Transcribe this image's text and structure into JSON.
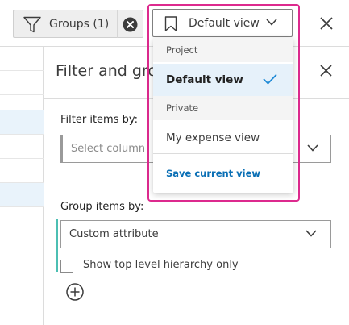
{
  "toolbar": {
    "groups_label": "Groups (1)",
    "view_selected": "Default view",
    "funnel_icon": "funnel-icon",
    "clear_icon": "clear-filter-icon",
    "bookmark_icon": "bookmark-icon",
    "close_icon": "close-icon"
  },
  "left_list": {
    "selected_rows": [
      2,
      6
    ]
  },
  "panel": {
    "title": "Filter and gro",
    "filter": {
      "label": "Filter items by:",
      "placeholder": "Select column"
    },
    "group": {
      "label": "Group items by:",
      "value": "Custom attribute"
    },
    "checkbox_label": "Show top level hierarchy only",
    "checkbox_checked": false,
    "add_icon": "add-circle-icon"
  },
  "view_menu": {
    "groups": [
      {
        "label": "Project",
        "items": [
          {
            "label": "Default view",
            "selected": true
          }
        ]
      },
      {
        "label": "Private",
        "items": [
          {
            "label": "My expense view",
            "selected": false
          }
        ]
      }
    ],
    "save_label": "Save current view"
  },
  "colors": {
    "accent_teal": "#4cbfb3",
    "highlight_magenta": "#dd2a8e",
    "link_blue": "#0a6fb5",
    "selected_bg": "#e6f1fa",
    "check_blue": "#1f8ad6"
  }
}
